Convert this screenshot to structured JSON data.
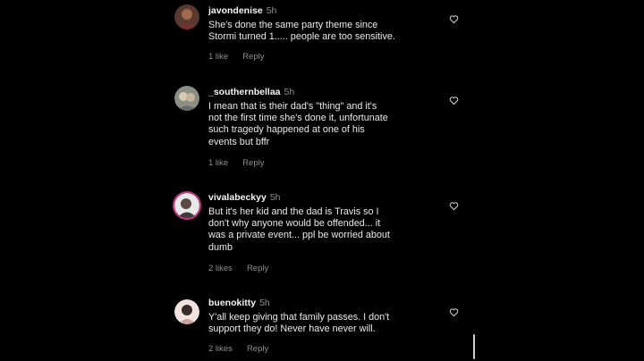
{
  "comments": [
    {
      "username": "javondenise",
      "time": "5h",
      "lines": [
        "She's done the same party theme since",
        "Stormi turned 1..... people are too sensitive."
      ],
      "likes": "1 like",
      "reply": "Reply"
    },
    {
      "username": "_southernbellaa",
      "time": "5h",
      "lines": [
        "I mean that is their dad's \"thing\" and it's",
        "not the first time she's done it, unfortunate",
        "such tragedy happened at one of his",
        "events but bffr"
      ],
      "likes": "1 like",
      "reply": "Reply"
    },
    {
      "username": "vivalabeckyy",
      "time": "5h",
      "lines": [
        "But it's her kid and the dad is Travis so I",
        "don't why anyone would be offended... it",
        "was a private event... ppl be worried about",
        "dumb"
      ],
      "likes": "2 likes",
      "reply": "Reply"
    },
    {
      "username": "buenokitty",
      "time": "5h",
      "lines": [
        "Y'all keep giving that family passes. I don't",
        "support      they do! Never have never will."
      ],
      "likes": "2 likes",
      "reply": "Reply"
    }
  ],
  "icons": {
    "like": "heart-outline-icon"
  },
  "colors": {
    "background": "#000000",
    "muted": "#8e8e8e",
    "ring": "#c13584"
  }
}
